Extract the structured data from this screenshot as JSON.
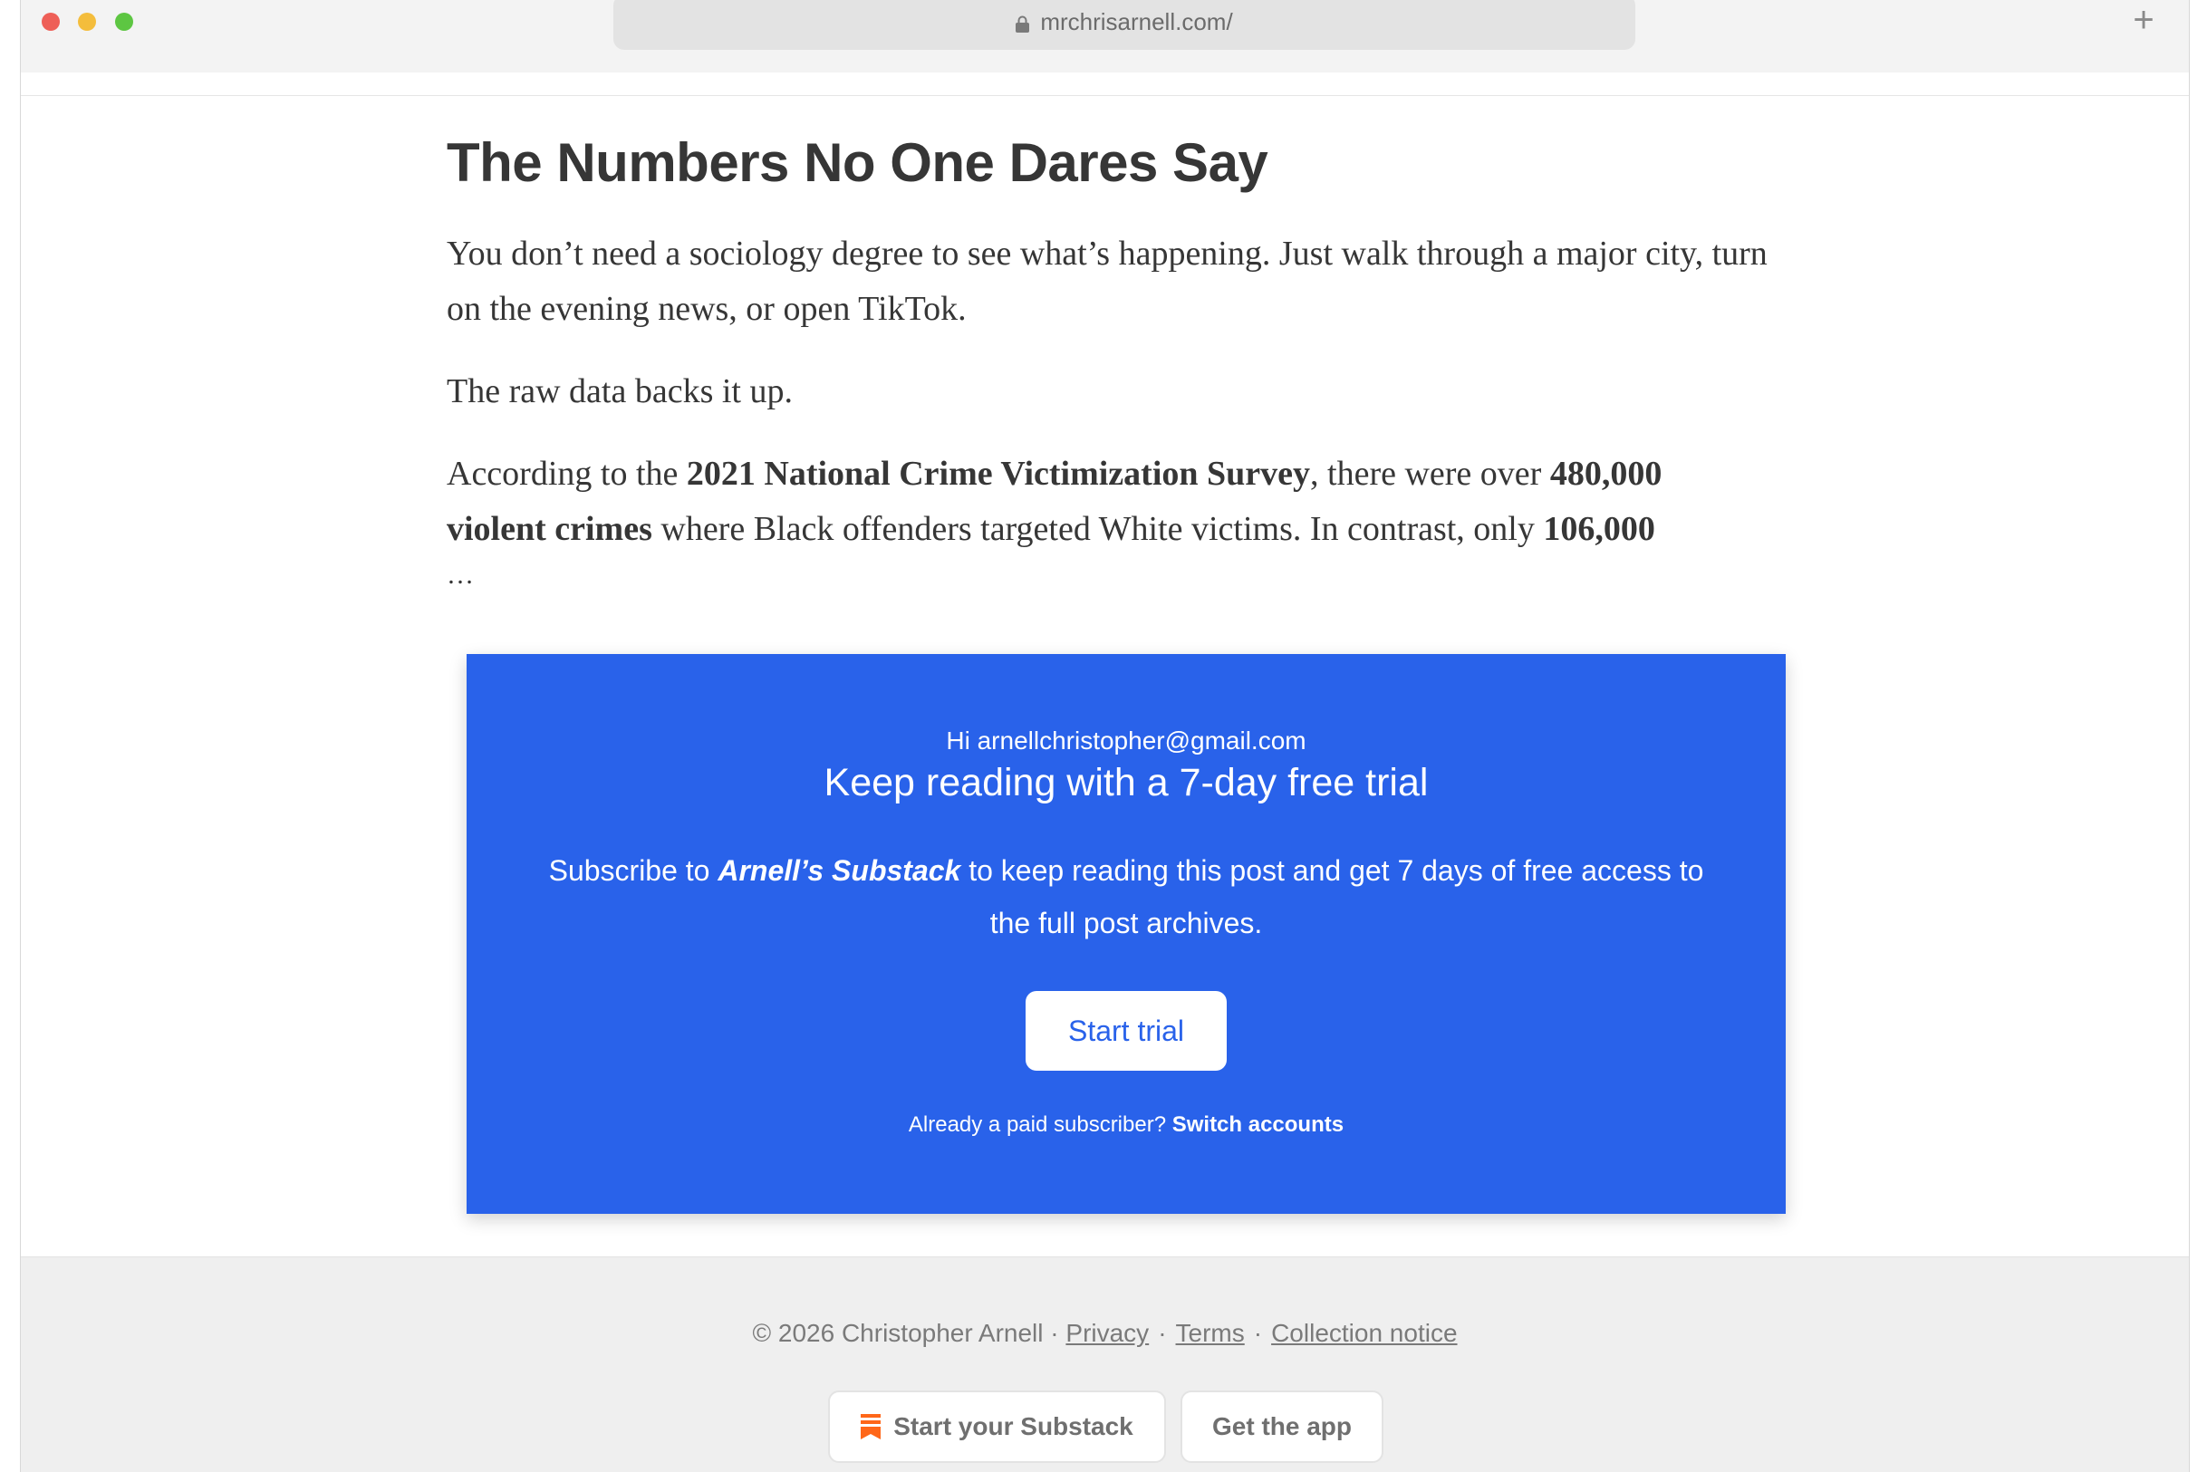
{
  "browser": {
    "url": "mrchrisarnell.com/",
    "new_tab_glyph": "+"
  },
  "article": {
    "title": "The Numbers No One Dares Say",
    "p1": "You don’t need a sociology degree to see what’s happening. Just walk through a major city, turn on the evening news, or open TikTok.",
    "p2": "The raw data backs it up.",
    "p3_a": "According to the ",
    "p3_b": "2021 National Crime Victimization Survey",
    "p3_c": ", there were over ",
    "p3_d": "480,000 violent crimes",
    "p3_e": " where Black offenders targeted White victims. In contrast, only ",
    "p3_f": "106,000",
    "ellipsis": "…"
  },
  "paywall": {
    "greeting": "Hi arnellchristopher@gmail.com",
    "headline": "Keep reading with a 7-day free trial",
    "desc_a": "Subscribe to ",
    "desc_brand": "Arnell’s Substack",
    "desc_b": " to keep reading this post and get 7 days of free access to the full post archives.",
    "cta": "Start trial",
    "login_text": "Already a paid subscriber? ",
    "login_link": "Switch accounts",
    "accent": "#2962ea"
  },
  "footer": {
    "copyright": "© 2026 Christopher Arnell · ",
    "privacy": "Privacy",
    "terms": "Terms",
    "collection": "Collection notice",
    "sep": "·",
    "start_substack": "Start your Substack",
    "get_app": "Get the app",
    "substack_color": "#ff6719"
  }
}
